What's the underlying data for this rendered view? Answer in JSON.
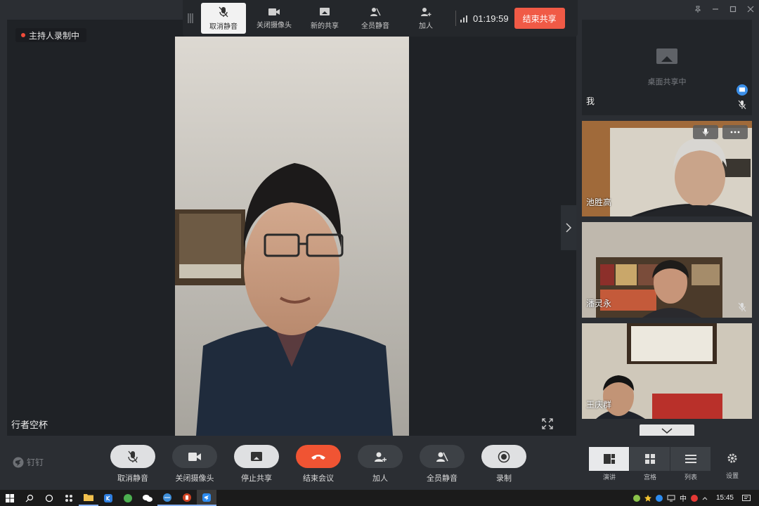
{
  "recording_badge": "主持人录制中",
  "main_speaker_name": "行者空杯",
  "top_toolbar": {
    "buttons": [
      {
        "label": "取消静音",
        "icon": "mic-muted-icon",
        "active": true
      },
      {
        "label": "关闭摄像头",
        "icon": "camera-icon",
        "active": false
      },
      {
        "label": "新的共享",
        "icon": "share-screen-icon",
        "active": false
      },
      {
        "label": "全员静音",
        "icon": "mute-all-icon",
        "active": false
      },
      {
        "label": "加人",
        "icon": "add-person-icon",
        "active": false
      }
    ],
    "timer": "01:19:59",
    "end_share_label": "结束共享"
  },
  "participants": [
    {
      "name": "我",
      "status_text": "桌面共享中",
      "muted": true,
      "type": "self"
    },
    {
      "name": "池胜高",
      "muted": false,
      "type": "video"
    },
    {
      "name": "潘灵永",
      "muted": true,
      "type": "video"
    },
    {
      "name": "王庆群",
      "muted": false,
      "type": "video"
    }
  ],
  "bottom_controls": [
    {
      "label": "取消静音",
      "icon": "mic-muted-icon",
      "style": "light"
    },
    {
      "label": "关闭摄像头",
      "icon": "camera-icon",
      "style": "dark"
    },
    {
      "label": "停止共享",
      "icon": "share-screen-icon",
      "style": "light"
    },
    {
      "label": "结束会议",
      "icon": "hang-up-icon",
      "style": "red"
    },
    {
      "label": "加人",
      "icon": "add-person-icon",
      "style": "dark"
    },
    {
      "label": "全员静音",
      "icon": "mute-all-icon",
      "style": "dark"
    },
    {
      "label": "录制",
      "icon": "record-icon",
      "style": "light"
    }
  ],
  "brand_name": "钉钉",
  "view_modes": {
    "labels": [
      "演讲",
      "宫格",
      "列表"
    ],
    "selected": "演讲"
  },
  "settings_label": "设置",
  "taskbar": {
    "clock": "15:45",
    "ime": "中"
  },
  "colors": {
    "accent_red": "#f05433",
    "end_share": "#f05a46",
    "panel": "#2b2e33",
    "stage": "#1f2226"
  }
}
